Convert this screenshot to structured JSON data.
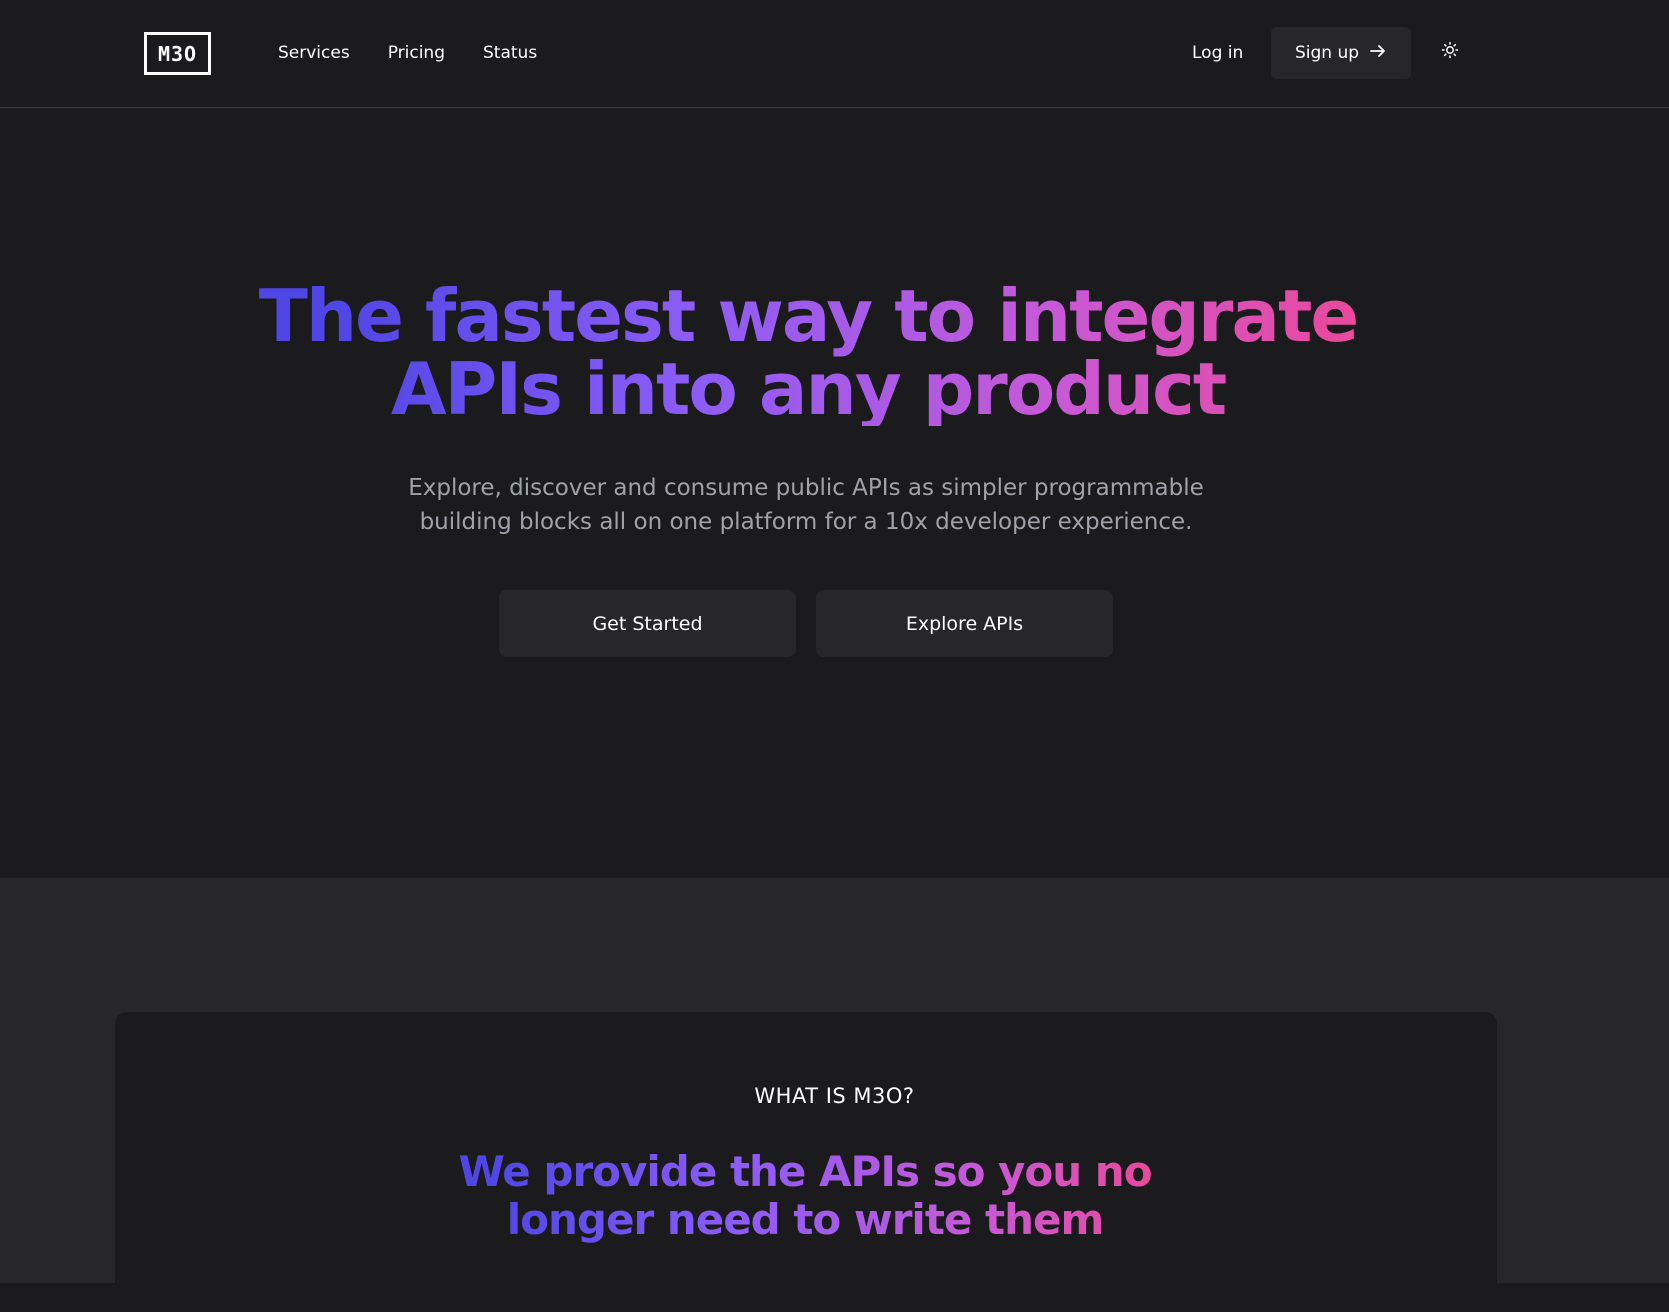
{
  "header": {
    "logo_text": "M3O",
    "nav": [
      "Services",
      "Pricing",
      "Status"
    ],
    "login_label": "Log in",
    "signup_label": "Sign up",
    "signup_icon": "arrow-right-icon",
    "theme_icon": "sun-icon"
  },
  "hero": {
    "title": "The fastest way to integrate APIs into any product",
    "subtitle": "Explore, discover and consume public APIs as simpler programmable building blocks all on one platform for a 10x developer experience.",
    "primary_button": "Get Started",
    "secondary_button": "Explore APIs"
  },
  "about": {
    "eyebrow": "WHAT IS M3O?",
    "title": "We provide the APIs so you no longer need to write them"
  },
  "colors": {
    "background": "#1b1b1e",
    "section_background": "#27272a",
    "button_background": "#27272a",
    "gradient_start": "#4f46e5",
    "gradient_mid": "#8b5cf6",
    "gradient_end": "#ec4899",
    "muted_text": "#a1a1aa"
  }
}
